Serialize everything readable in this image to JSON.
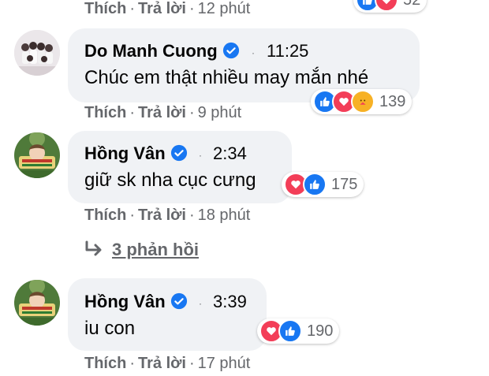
{
  "labels": {
    "like": "Thích",
    "reply": "Trả lời",
    "sep": "·"
  },
  "colors": {
    "bubble": "#f0f2f5",
    "secondary": "#65676b",
    "blue": "#1877f2",
    "red": "#f33e58"
  },
  "top_partial": {
    "time": "12 phút",
    "reaction_count": "52"
  },
  "comments": [
    {
      "name": "Do Manh Cuong",
      "timestamp": "11:25",
      "text": "Chúc em thật nhiều may mắn nhé",
      "reactions": [
        "like-icon",
        "love-icon",
        "care-icon"
      ],
      "reaction_count": "139",
      "time": "9 phút"
    },
    {
      "name": "Hồng Vân",
      "timestamp": "2:34",
      "text": "giữ sk nha cục cưng",
      "reactions": [
        "love-icon",
        "like-icon"
      ],
      "reaction_count": "175",
      "time": "18 phút"
    },
    {
      "name": "Hồng Vân",
      "timestamp": "3:39",
      "text": "iu con",
      "reactions": [
        "love-icon",
        "like-icon"
      ],
      "reaction_count": "190",
      "time": "17 phút"
    }
  ],
  "replies_link": {
    "label": "3 phản hồi",
    "icon": "reply-arrow-icon"
  }
}
